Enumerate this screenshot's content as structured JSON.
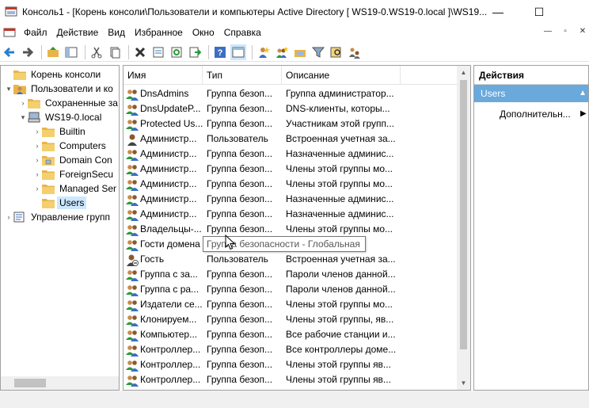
{
  "window": {
    "title": "Консоль1 - [Корень консоли\\Пользователи и компьютеры Active Directory [ WS19-0.WS19-0.local ]\\WS19...",
    "minimize_glyph": "—",
    "maximize_glyph": "☐"
  },
  "menu": {
    "items": [
      "Файл",
      "Действие",
      "Вид",
      "Избранное",
      "Окно",
      "Справка"
    ],
    "mdi": [
      "—",
      "▫",
      "✕"
    ]
  },
  "tree": {
    "nodes": [
      {
        "label": "Корень консоли",
        "level": 0,
        "expander": "",
        "icon": "folder-icon"
      },
      {
        "label": "Пользователи и ко",
        "level": 1,
        "expander": "▾",
        "icon": "ad-users-computers-icon"
      },
      {
        "label": "Сохраненные за",
        "level": 2,
        "expander": "›",
        "icon": "folder-icon"
      },
      {
        "label": "WS19-0.local",
        "level": 2,
        "expander": "▾",
        "icon": "domain-icon"
      },
      {
        "label": "Builtin",
        "level": 3,
        "expander": "›",
        "icon": "folder-icon"
      },
      {
        "label": "Computers",
        "level": 3,
        "expander": "›",
        "icon": "folder-icon"
      },
      {
        "label": "Domain Con",
        "level": 3,
        "expander": "›",
        "icon": "ou-folder-icon"
      },
      {
        "label": "ForeignSecu",
        "level": 3,
        "expander": "›",
        "icon": "folder-icon"
      },
      {
        "label": "Managed Ser",
        "level": 3,
        "expander": "›",
        "icon": "folder-icon"
      },
      {
        "label": "Users",
        "level": 3,
        "expander": "",
        "icon": "folder-icon",
        "selected": true
      },
      {
        "label": "Управление групп",
        "level": 0,
        "expander": "›",
        "icon": "gpm-icon"
      }
    ]
  },
  "list": {
    "columns": [
      "Имя",
      "Тип",
      "Описание"
    ],
    "rows": [
      {
        "name": "DnsAdmins",
        "type": "Группа безоп...",
        "desc": "Группа администратор...",
        "icon": "group-icon"
      },
      {
        "name": "DnsUpdateP...",
        "type": "Группа безоп...",
        "desc": "DNS-клиенты, которы...",
        "icon": "group-icon"
      },
      {
        "name": "Protected Us...",
        "type": "Группа безоп...",
        "desc": "Участникам этой групп...",
        "icon": "group-icon"
      },
      {
        "name": "Администр...",
        "type": "Пользователь",
        "desc": "Встроенная учетная за...",
        "icon": "user-icon"
      },
      {
        "name": "Администр...",
        "type": "Группа безоп...",
        "desc": "Назначенные админис...",
        "icon": "group-icon"
      },
      {
        "name": "Администр...",
        "type": "Группа безоп...",
        "desc": "Члены этой группы мо...",
        "icon": "group-icon"
      },
      {
        "name": "Администр...",
        "type": "Группа безоп...",
        "desc": "Члены этой группы мо...",
        "icon": "group-icon"
      },
      {
        "name": "Администр...",
        "type": "Группа безоп...",
        "desc": "Назначенные админис...",
        "icon": "group-icon"
      },
      {
        "name": "Администр...",
        "type": "Группа безоп...",
        "desc": "Назначенные админис...",
        "icon": "group-icon"
      },
      {
        "name": "Владельцы-...",
        "type": "Группа безоп...",
        "desc": "Члены этой группы мо...",
        "icon": "group-icon"
      },
      {
        "name": "Гости домена",
        "type": "",
        "desc": "",
        "icon": "group-icon"
      },
      {
        "name": "Гость",
        "type": "Пользователь",
        "desc": "Встроенная учетная за...",
        "icon": "user-disabled-icon"
      },
      {
        "name": "Группа с за...",
        "type": "Группа безоп...",
        "desc": "Пароли членов данной...",
        "icon": "group-icon"
      },
      {
        "name": "Группа с ра...",
        "type": "Группа безоп...",
        "desc": "Пароли членов данной...",
        "icon": "group-icon"
      },
      {
        "name": "Издатели се...",
        "type": "Группа безоп...",
        "desc": "Члены этой группы мо...",
        "icon": "group-icon"
      },
      {
        "name": "Клонируем...",
        "type": "Группа безоп...",
        "desc": "Члены этой группы, яв...",
        "icon": "group-icon"
      },
      {
        "name": "Компьютер...",
        "type": "Группа безоп...",
        "desc": "Все рабочие станции и...",
        "icon": "group-icon"
      },
      {
        "name": "Контроллер...",
        "type": "Группа безоп...",
        "desc": "Все контроллеры доме...",
        "icon": "group-icon"
      },
      {
        "name": "Контроллер...",
        "type": "Группа безоп...",
        "desc": "Члены этой группы яв...",
        "icon": "group-icon"
      },
      {
        "name": "Контроллер...",
        "type": "Группа безоп...",
        "desc": "Члены этой группы яв...",
        "icon": "group-icon"
      }
    ],
    "tooltip": "Группа безопасности - Глобальная"
  },
  "actions": {
    "header": "Действия",
    "section": "Users",
    "section_arrow": "▲",
    "item": "Дополнительн...",
    "item_arrow": "▶"
  },
  "colors": {
    "selection": "#cce8ff",
    "actions_section": "#6aa9dc",
    "folder": "#e8b44a"
  }
}
